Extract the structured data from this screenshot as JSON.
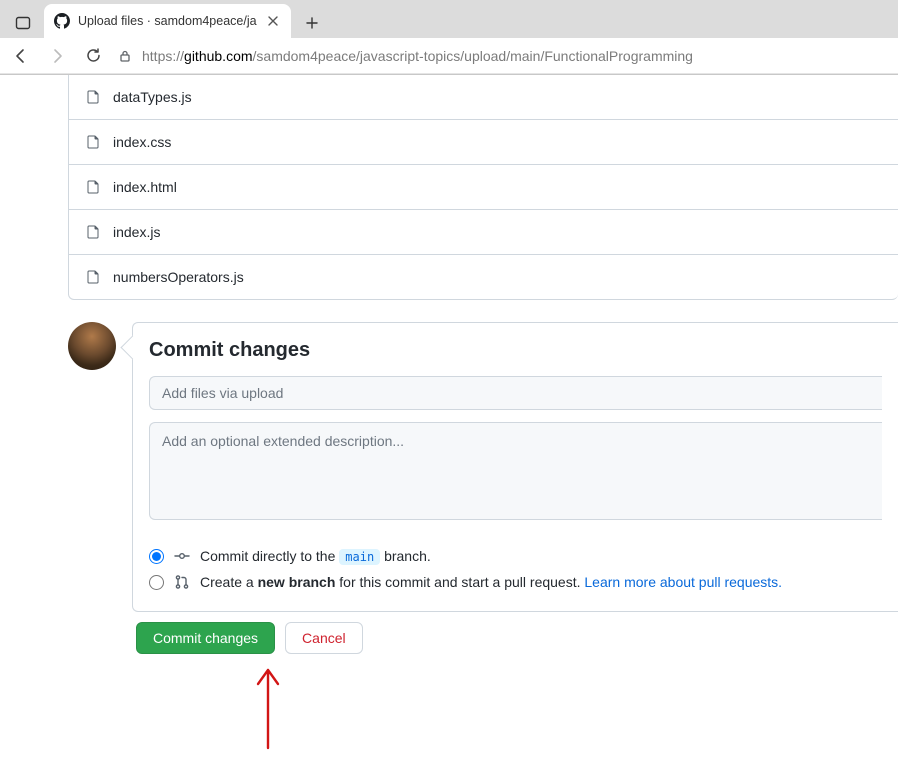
{
  "browser": {
    "tab_title": "Upload files · samdom4peace/ja",
    "url_prefix": "https://",
    "url_host": "github.com",
    "url_path": "/samdom4peace/javascript-topics/upload/main/FunctionalProgramming"
  },
  "files": [
    "dataTypes.js",
    "index.css",
    "index.html",
    "index.js",
    "numbersOperators.js"
  ],
  "commit": {
    "heading": "Commit changes",
    "summary_placeholder": "Add files via upload",
    "description_placeholder": "Add an optional extended description...",
    "radio_direct_pre": "Commit directly to the",
    "radio_direct_branch": "main",
    "radio_direct_post": "branch.",
    "radio_new_pre": "Create a",
    "radio_new_bold": "new branch",
    "radio_new_post": "for this commit and start a pull request.",
    "radio_new_link": "Learn more about pull requests.",
    "commit_btn": "Commit changes",
    "cancel_btn": "Cancel"
  }
}
